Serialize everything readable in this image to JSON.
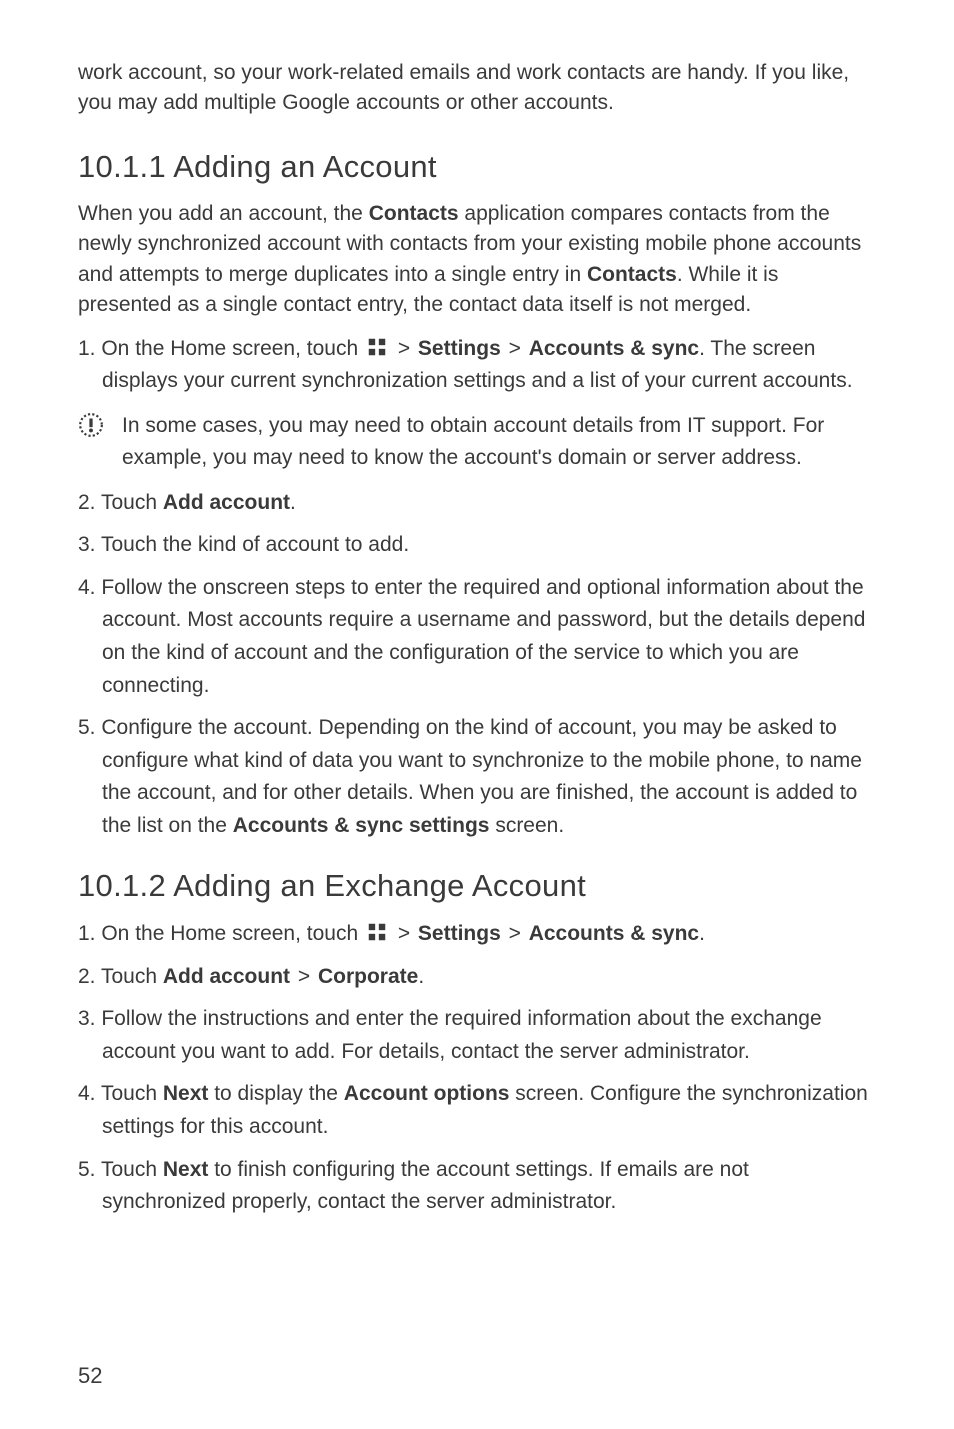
{
  "intro": "work account, so your work-related emails and work contacts are handy. If you like, you may add multiple Google accounts or other accounts.",
  "section1": {
    "heading": "10.1.1  Adding an Account",
    "para1_pre": "When you add an account, the ",
    "para1_bold1": "Contacts",
    "para1_mid": " application compares contacts from the newly synchronized account with contacts from your existing mobile phone accounts and attempts to merge duplicates into a single entry in ",
    "para1_bold2": "Contacts",
    "para1_post": ". While it is presented as a single contact entry, the contact data itself is not merged.",
    "step1_pre": "1. On the Home screen, touch ",
    "step1_gt1": " > ",
    "step1_bold1": "Settings",
    "step1_gt2": " > ",
    "step1_bold2": "Accounts & sync",
    "step1_post": ". The screen displays your current synchronization settings and a list of your current accounts.",
    "note": "In some cases, you may need to obtain account details from IT support. For example, you may need to know the account's domain or server address.",
    "step2_pre": "2. Touch ",
    "step2_bold": "Add account",
    "step2_post": ".",
    "step3": "3. Touch the kind of account to add.",
    "step4": "4. Follow the onscreen steps to enter the required and optional information about the account. Most accounts require a username and password, but the details depend on the kind of account and the configuration of the service to which you are connecting.",
    "step5_pre": "5. Configure the account. Depending on the kind of account, you may be asked to configure what kind of data you want to synchronize to the mobile phone, to name the account, and for other details. When you are finished, the account is added to the list on the ",
    "step5_bold": "Accounts & sync settings",
    "step5_post": " screen."
  },
  "section2": {
    "heading": "10.1.2  Adding an Exchange Account",
    "step1_pre": "1. On the Home screen, touch ",
    "step1_gt1": " > ",
    "step1_bold1": "Settings",
    "step1_gt2": " > ",
    "step1_bold2": "Accounts & sync",
    "step1_post": ".",
    "step2_pre": "2. Touch ",
    "step2_bold1": "Add account",
    "step2_gt": " > ",
    "step2_bold2": "Corporate",
    "step2_post": ".",
    "step3": "3. Follow the instructions and enter the required information about the exchange account you want to add. For details, contact the server administrator.",
    "step4_pre": "4. Touch ",
    "step4_bold1": "Next",
    "step4_mid": " to display the ",
    "step4_bold2": "Account options",
    "step4_post": " screen. Configure the synchronization settings for this account.",
    "step5_pre": "5. Touch ",
    "step5_bold": "Next",
    "step5_post": " to finish configuring the account settings. If emails are not synchronized properly, contact the server administrator."
  },
  "pageNumber": "52"
}
